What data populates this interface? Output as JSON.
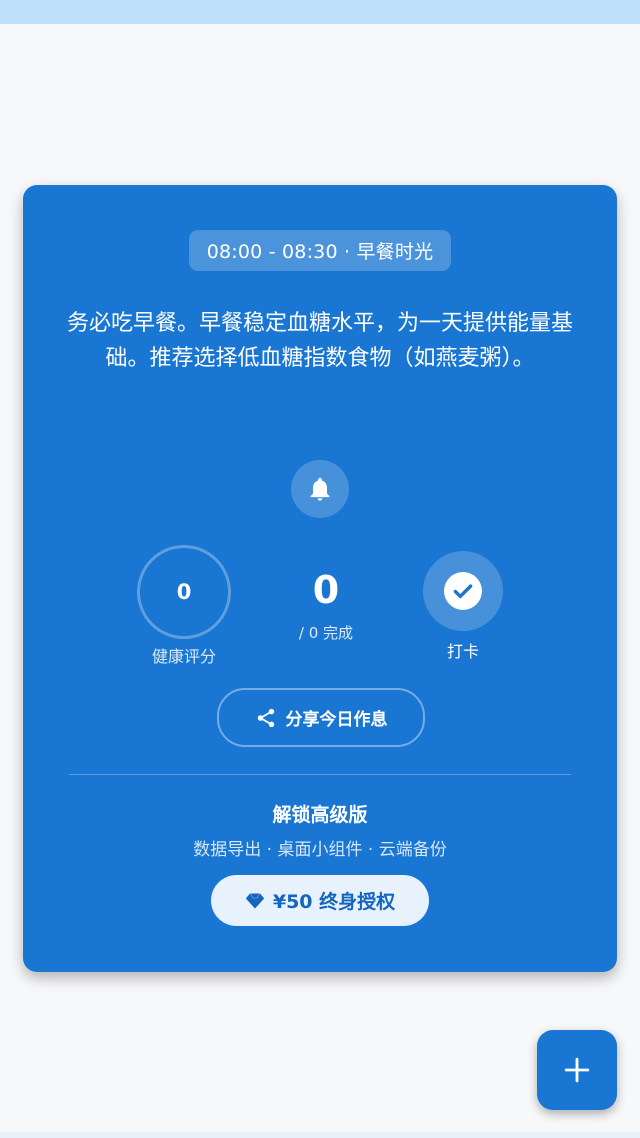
{
  "time_slot": "08:00 - 08:30 · 早餐时光",
  "advice": "务必吃早餐。早餐稳定血糖水平，为一天提供能量基础。推荐选择低血糖指数食物（如燕麦粥）。",
  "health_score": {
    "value": "0",
    "label": "健康评分"
  },
  "completion": {
    "count": "0",
    "subtitle": "/ 0 完成"
  },
  "checkin": {
    "label": "打卡"
  },
  "share": {
    "label": "分享今日作息"
  },
  "premium": {
    "title": "解锁高级版",
    "features": "数据导出 · 桌面小组件 · 云端备份",
    "buy_label": "¥50 终身授权"
  },
  "icons": {
    "bell": "bell-icon",
    "check": "check-circle-icon",
    "share": "share-icon",
    "diamond": "diamond-icon",
    "add": "plus-icon"
  },
  "colors": {
    "card": "#1976d2",
    "buy_button_bg": "#e8f2fc",
    "buy_button_text": "#1565c0",
    "background": "#f7f8fa",
    "status_bar": "#bfe0fb"
  }
}
